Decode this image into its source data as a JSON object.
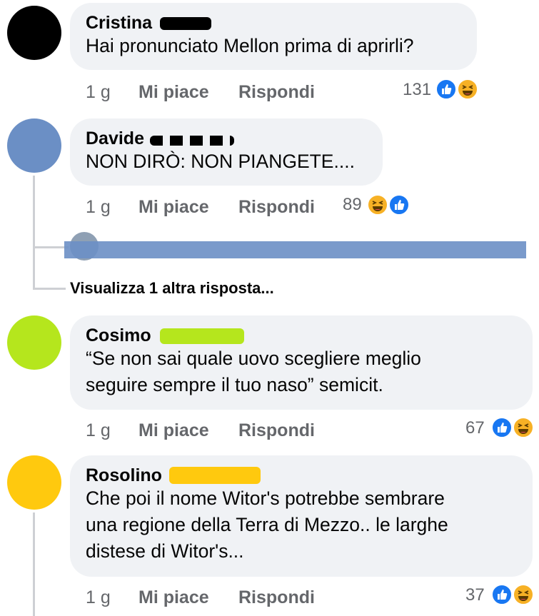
{
  "comments": [
    {
      "author": "Cristina",
      "text": "Hai pronunciato Mellon prima di aprirli?",
      "time": "1 g",
      "like": "Mi piace",
      "reply": "Rispondi",
      "count": "131",
      "redact_color": "#000000",
      "avatar_color": "#000000"
    },
    {
      "author": "Davide",
      "text": "NON DIRÒ: NON PIANGETE....",
      "time": "1 g",
      "like": "Mi piace",
      "reply": "Rispondi",
      "count": "89",
      "redact_color": "#000000",
      "avatar_color": "#6b8fc5"
    },
    {
      "author": "Cosimo",
      "text_lines": [
        "“Se non sai quale uovo scegliere meglio",
        "seguire sempre il tuo naso” semicit."
      ],
      "time": "1 g",
      "like": "Mi piace",
      "reply": "Rispondi",
      "count": "67",
      "redact_color": "#b5e61d",
      "avatar_color": "#b5e61d"
    },
    {
      "author": "Rosolino",
      "text_lines": [
        "Che poi il nome Witor's potrebbe sembrare",
        "una regione della Terra di Mezzo.. le larghe",
        "distese di Witor's..."
      ],
      "time": "1 g",
      "like": "Mi piace",
      "reply": "Rispondi",
      "count": "37",
      "redact_color": "#ffc90e",
      "avatar_color": "#ffc90e"
    }
  ],
  "view_more": "Visualizza 1 altra risposta...",
  "colors": {
    "like_blue": "#1877f2",
    "haha_yellow": "#f7b125",
    "meta_gray": "#65676b",
    "bubble": "#f0f2f5",
    "redact_blue": "#6b8fc5"
  }
}
